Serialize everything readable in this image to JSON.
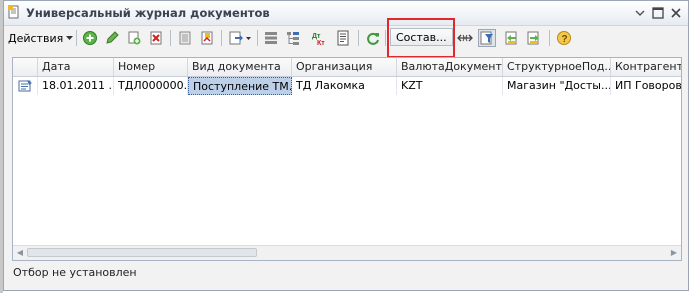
{
  "window": {
    "title": "Универсальный журнал документов",
    "icons": {
      "app": "document-app-icon",
      "menu": "chevron-down-icon",
      "maximize": "maximize-icon",
      "close": "close-icon"
    }
  },
  "toolbar": {
    "actions_label": "Действия",
    "composition_label": "Состав...",
    "icons": [
      "add-icon",
      "edit-icon",
      "copy-icon",
      "delete-icon",
      "post-icon",
      "unpost-icon",
      "export-icon",
      "list-view-icon",
      "tree-view-icon",
      "dt-kt-icon",
      "report-icon",
      "refresh-icon",
      "auto-width-icon",
      "filter-icon",
      "move-left-icon",
      "move-right-icon",
      "help-icon"
    ],
    "colors": {
      "highlight": "#e0282d"
    }
  },
  "table": {
    "columns": [
      "Дата",
      "Номер",
      "Вид документа",
      "Организация",
      "ВалютаДокумента",
      "СтруктурноеПод...",
      "Контрагент"
    ],
    "rows": [
      {
        "icon": "document-icon",
        "cells": [
          "18.01.2011 ...",
          "ТДЛ000000...",
          "Поступление ТМ...",
          "ТД Лакомка",
          "KZT",
          "Магазин \"Досты...",
          "ИП Говоров Л"
        ]
      }
    ]
  },
  "status": {
    "filter_text": "Отбор не установлен"
  }
}
